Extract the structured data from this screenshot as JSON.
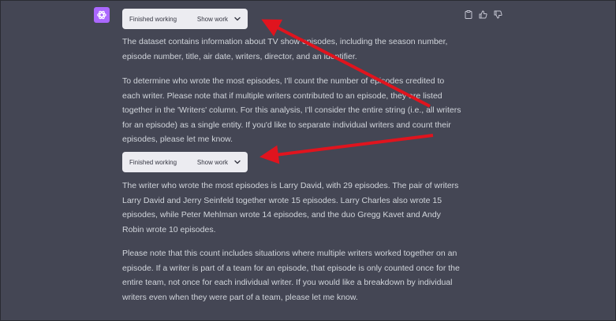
{
  "message": {
    "status_pill_1": {
      "status": "Finished working",
      "toggle": "Show work"
    },
    "paragraph_1": "The dataset contains information about TV show episodes, including the season number, episode number, title, air date, writers, director, and an identifier.",
    "paragraph_2": "To determine who wrote the most episodes, I'll count the number of episodes credited to each writer. Please note that if multiple writers contributed to an episode, they are listed together in the 'Writers' column. For this analysis, I'll consider the entire string (i.e., all writers for an episode) as a single entity. If you'd like to separate individual writers and count their episodes, please let me know.",
    "status_pill_2": {
      "status": "Finished working",
      "toggle": "Show work"
    },
    "paragraph_3": "The writer who wrote the most episodes is Larry David, with 29 episodes. The pair of writers Larry David and Jerry Seinfeld together wrote 15 episodes. Larry Charles also wrote 15 episodes, while Peter Mehlman wrote 14 episodes, and the duo Gregg Kavet and Andy Robin wrote 10 episodes.",
    "paragraph_4": "Please note that this count includes situations where multiple writers worked together on an episode. If a writer is part of a team for an episode, that episode is only counted once for the entire team, not once for each individual writer. If you would like a breakdown by individual writers even when they were part of a team, please let me know."
  },
  "icons": {
    "avatar": "openai-logo-icon",
    "copy": "clipboard-icon",
    "like": "thumbs-up-icon",
    "dislike": "thumbs-down-icon",
    "chevron": "chevron-down-icon"
  },
  "colors": {
    "background": "#444654",
    "text": "#d1d5db",
    "avatar": "#ab68ff",
    "pill": "#ececf1",
    "annotation_arrow": "#e0141e"
  }
}
